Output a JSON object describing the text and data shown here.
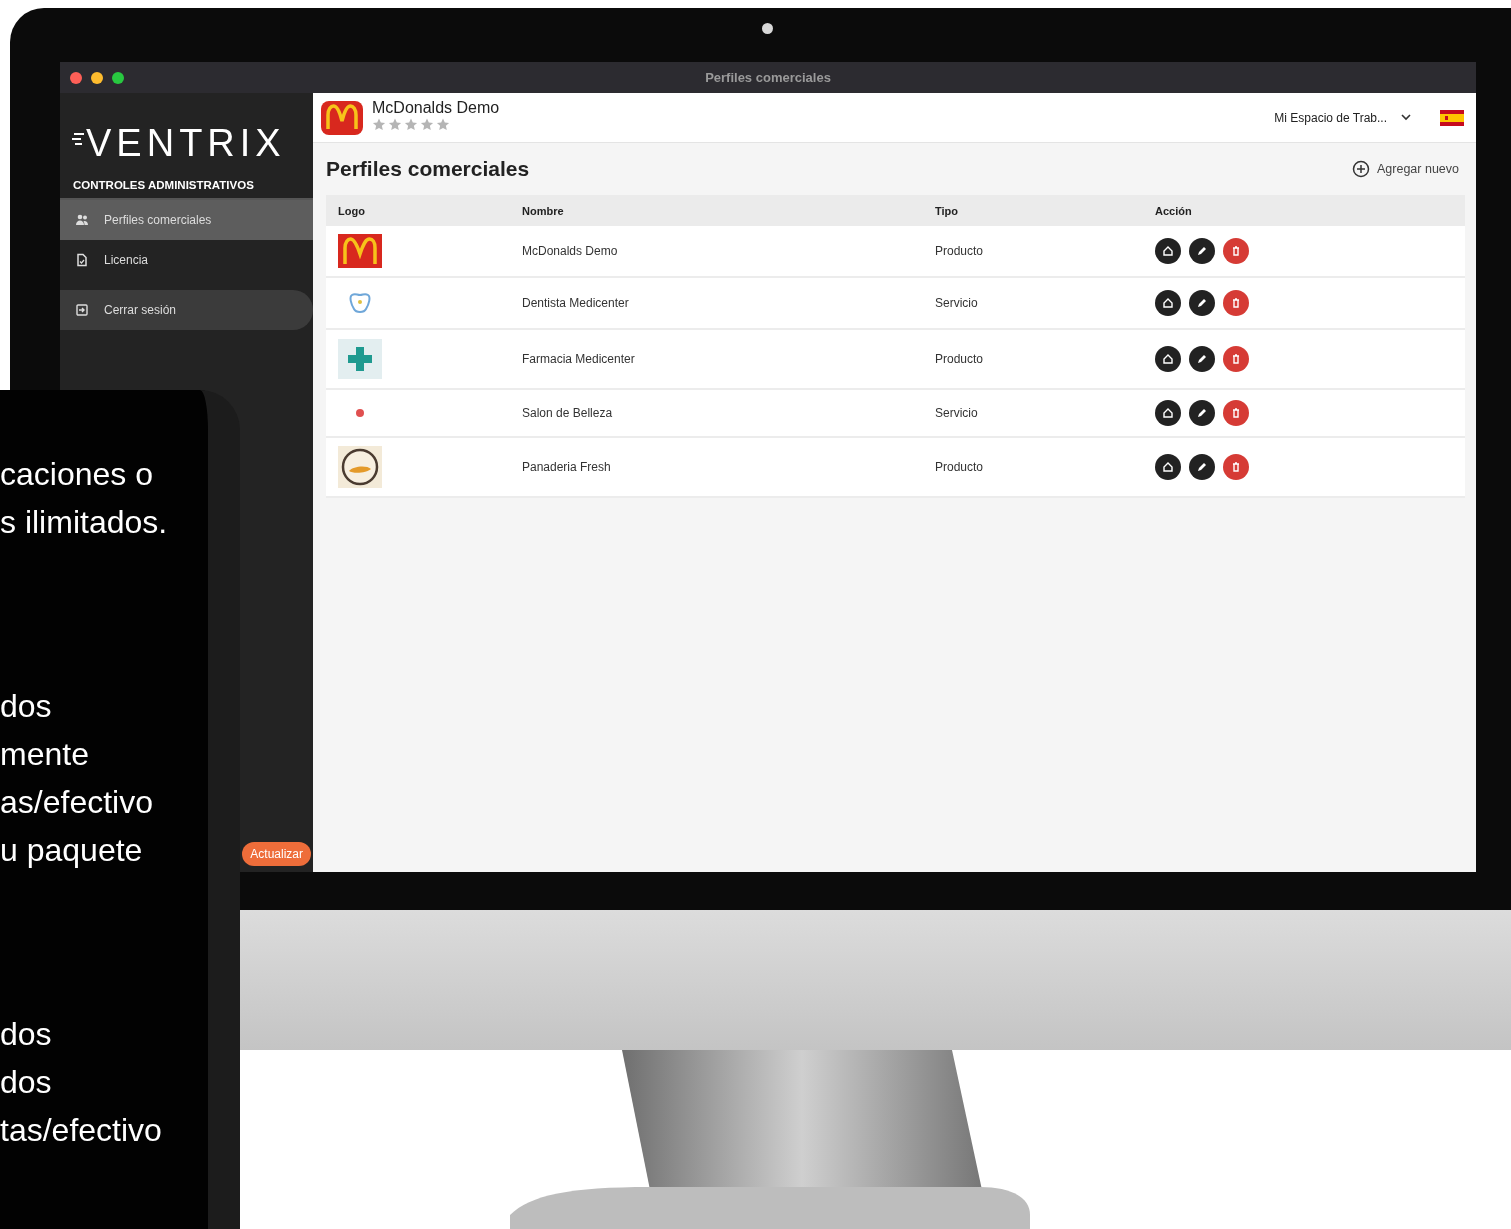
{
  "window": {
    "title": "Perfiles comerciales"
  },
  "sidebar": {
    "logo": "VENTRIX",
    "section": "CONTROLES ADMINISTRATIVOS",
    "items": [
      {
        "label": "Perfiles comerciales",
        "kind": "people",
        "selected": true
      },
      {
        "label": "Licencia",
        "kind": "document",
        "selected": false
      },
      {
        "label": "Cerrar sesión",
        "kind": "logout",
        "selected": false
      }
    ],
    "upgrade_button": "Actualizar"
  },
  "header": {
    "business": "McDonalds Demo",
    "stars": 0,
    "workspace": "Mi Espacio de Trab..."
  },
  "page": {
    "title": "Perfiles comerciales",
    "add_button": "Agregar nuevo"
  },
  "table": {
    "columns": [
      "Logo",
      "Nombre",
      "Tipo",
      "Acción"
    ],
    "rows": [
      {
        "kind": "arches",
        "name": "McDonalds Demo",
        "type": "Producto"
      },
      {
        "kind": "tooth",
        "name": "Dentista Medicenter",
        "type": "Servicio"
      },
      {
        "kind": "cross",
        "name": "Farmacia Medicenter",
        "type": "Producto"
      },
      {
        "kind": "dot",
        "name": "Salon de Belleza",
        "type": "Servicio"
      },
      {
        "kind": "bread",
        "name": "Panaderia Fresh",
        "type": "Producto"
      }
    ]
  },
  "phone": {
    "paragraphs": [
      [
        "caciones o",
        "s ilimitados."
      ],
      [
        "dos",
        "mente",
        "as/efectivo",
        "u paquete"
      ],
      [
        "dos",
        "dos",
        "tas/efectivo"
      ]
    ]
  }
}
